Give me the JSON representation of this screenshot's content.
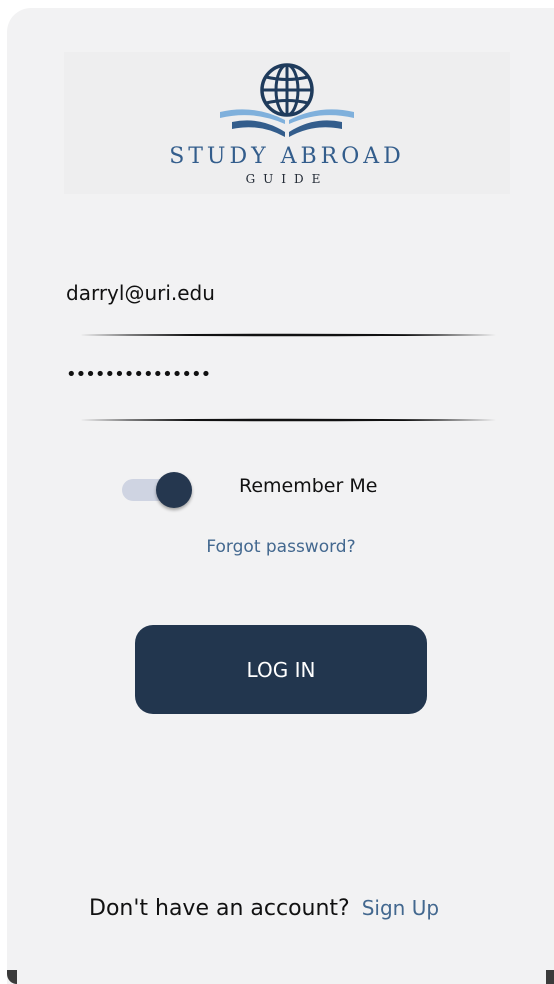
{
  "logo": {
    "title": "STUDY ABROAD",
    "subtitle": "GUIDE",
    "icon": "globe-with-book-icon",
    "colors": {
      "primary": "#335d8c",
      "accent": "#7fb0dc",
      "dark": "#1f3b5c"
    }
  },
  "login_form": {
    "email_value": "darryl@uri.edu",
    "password_value": "•••••••••••••••",
    "remember_me": {
      "label": "Remember Me",
      "checked": true
    },
    "forgot_password_label": "Forgot password?",
    "login_button_label": "LOG IN"
  },
  "footer": {
    "prompt": "Don't have an account?",
    "signup_label": "Sign Up"
  },
  "colors": {
    "button_bg": "#22364e",
    "link": "#43688f",
    "toggle_track": "#cfd4e2",
    "toggle_knob": "#25374f",
    "background": "#f2f2f3"
  }
}
